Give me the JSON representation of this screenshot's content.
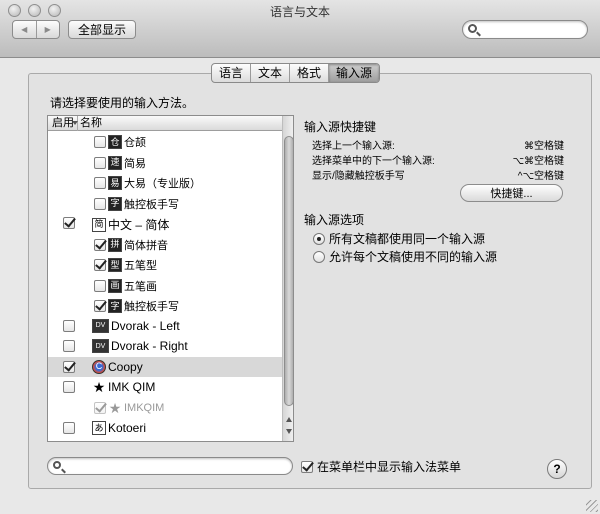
{
  "window": {
    "title": "语言与文本"
  },
  "toolbar": {
    "show_all_label": "全部显示",
    "back_glyph": "◀",
    "forward_glyph": "▶",
    "search_value": ""
  },
  "tabs": [
    {
      "label": "语言",
      "active": false
    },
    {
      "label": "文本",
      "active": false
    },
    {
      "label": "格式",
      "active": false
    },
    {
      "label": "输入源",
      "active": true
    }
  ],
  "instruction": "请选择要使用的输入方法。",
  "list": {
    "columns": {
      "enabled": "启用",
      "name": "名称"
    },
    "rows": [
      {
        "level": 1,
        "enabled": false,
        "icon": "仓",
        "icon_style": "dark",
        "label": "仓颉"
      },
      {
        "level": 1,
        "enabled": false,
        "icon": "速",
        "icon_style": "dark",
        "label": "简易"
      },
      {
        "level": 1,
        "enabled": false,
        "icon": "易",
        "icon_style": "dark",
        "label": "大易（专业版）"
      },
      {
        "level": 1,
        "enabled": false,
        "icon": "字",
        "icon_style": "dark",
        "label": "触控板手写"
      },
      {
        "level": 0,
        "enabled": true,
        "icon": "简",
        "icon_style": "plain",
        "label": "中文 – 简体"
      },
      {
        "level": 1,
        "enabled": true,
        "icon": "拼",
        "icon_style": "dark",
        "label": "简体拼音"
      },
      {
        "level": 1,
        "enabled": true,
        "icon": "型",
        "icon_style": "dark",
        "label": "五笔型"
      },
      {
        "level": 1,
        "enabled": false,
        "icon": "画",
        "icon_style": "dark",
        "label": "五笔画"
      },
      {
        "level": 1,
        "enabled": true,
        "icon": "字",
        "icon_style": "dark",
        "label": "触控板手写"
      },
      {
        "level": 0,
        "enabled": false,
        "icon": "DV",
        "icon_style": "wide",
        "label": "Dvorak - Left"
      },
      {
        "level": 0,
        "enabled": false,
        "icon": "DV",
        "icon_style": "wide",
        "label": "Dvorak - Right"
      },
      {
        "level": 0,
        "enabled": true,
        "icon": "C",
        "icon_style": "round",
        "label": "Coopy",
        "selected": true
      },
      {
        "level": 0,
        "enabled": false,
        "icon": "★",
        "icon_style": "star",
        "label": "IMK QIM"
      },
      {
        "level": 1,
        "enabled": true,
        "icon": "★",
        "icon_style": "star",
        "label": "IMKQIM",
        "dimmed": true
      },
      {
        "level": 0,
        "enabled": false,
        "icon": "あ",
        "icon_style": "plain",
        "label": "Kotoeri"
      }
    ]
  },
  "shortcuts": {
    "heading": "输入源快捷键",
    "items": [
      {
        "label": "选择上一个输入源:",
        "key": "⌘空格键"
      },
      {
        "label": "选择菜单中的下一个输入源:",
        "key": "⌥⌘空格键"
      },
      {
        "label": "显示/隐藏触控板手写",
        "key": "^⌥空格键"
      }
    ],
    "button_label": "快捷键..."
  },
  "options": {
    "heading": "输入源选项",
    "choices": [
      {
        "label": "所有文稿都使用同一个输入源",
        "selected": true
      },
      {
        "label": "允许每个文稿使用不同的输入源",
        "selected": false
      }
    ]
  },
  "bottom": {
    "search_value": "",
    "menu_toggle_label": "在菜单栏中显示输入法菜单",
    "menu_toggle_checked": true,
    "help_label": "?"
  }
}
